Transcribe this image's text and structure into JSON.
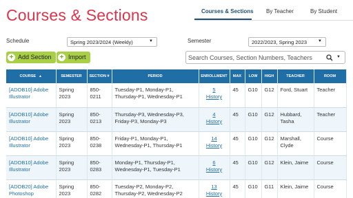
{
  "header": {
    "title": "Courses & Sections"
  },
  "tabs": [
    {
      "label": "Courses & Sections",
      "active": true
    },
    {
      "label": "By Teacher",
      "active": false
    },
    {
      "label": "By Student",
      "active": false
    }
  ],
  "filters": {
    "schedule_label": "Schedule",
    "schedule_value": "Spring 2023/2024 (Weekly)",
    "semester_label": "Semester",
    "semester_value": "2022/2023, Spring 2023"
  },
  "toolbar": {
    "add_section_label": "Add Section",
    "import_label": "Import"
  },
  "search": {
    "placeholder": "Search Courses, Section Numbers, Teachers"
  },
  "table": {
    "columns": [
      "COURSE",
      "SEMESTER",
      "SECTION #",
      "PERIOD",
      "ENROLLMENT",
      "MAX",
      "LOW",
      "HIGH",
      "TEACHER",
      "ROOM"
    ],
    "rows": [
      {
        "course": "[ADOB10] Adobe Illustrator",
        "semester": "Spring 2023",
        "section": "850-0211",
        "period": "Tuesday-P1, Monday-P1, Thursday-P1, Wednesday-P1",
        "enrollment": "5",
        "history": "History",
        "max": "45",
        "low": "G10",
        "high": "G12",
        "teacher": "Ford, Stuart",
        "room": "Teacher"
      },
      {
        "course": "[ADOB10] Adobe Illustrator",
        "semester": "Spring 2023",
        "section": "850-0213",
        "period": "Thursday-P3, Wednesday-P3, Friday-P3, Monday-P3",
        "enrollment": "4",
        "history": "History",
        "max": "45",
        "low": "G10",
        "high": "G12",
        "teacher": "Hubbard, Tasha",
        "room": "Teacher"
      },
      {
        "course": "[ADOB10] Adobe Illustrator",
        "semester": "Spring 2023",
        "section": "850-0238",
        "period": "Friday-P1, Monday-P1, Wednesday-P1, Thursday-P1",
        "enrollment": "14",
        "history": "History",
        "max": "45",
        "low": "G10",
        "high": "G12",
        "teacher": "Marshall, Clyde",
        "room": "Course"
      },
      {
        "course": "[ADOB10] Adobe Illustrator",
        "semester": "Spring 2023",
        "section": "850-0283",
        "period": "Monday-P1, Thursday-P1, Wednesday-P1, Tuesday-P1",
        "enrollment": "6",
        "history": "History",
        "max": "45",
        "low": "G10",
        "high": "G12",
        "teacher": "Klein, Jaime",
        "room": "Course"
      },
      {
        "course": "[ADOB20] Adobe Photoshop",
        "semester": "Spring 2023",
        "section": "850-0282",
        "period": "Tuesday-P2, Monday-P2, Thursday-P2, Wednesday-P2",
        "enrollment": "13",
        "history": "History",
        "max": "45",
        "low": "G10",
        "high": "G11",
        "teacher": "Klein, Jaime",
        "room": "Course"
      }
    ]
  },
  "colors": {
    "title": "#d9354c",
    "accent": "#1b4f78",
    "header_bg": "#1f6fa6",
    "button": "#a8cf45",
    "link": "#1f6fa6"
  },
  "icons": {
    "search": "search-icon",
    "add": "plus-icon",
    "sort": "sort-asc-icon"
  }
}
